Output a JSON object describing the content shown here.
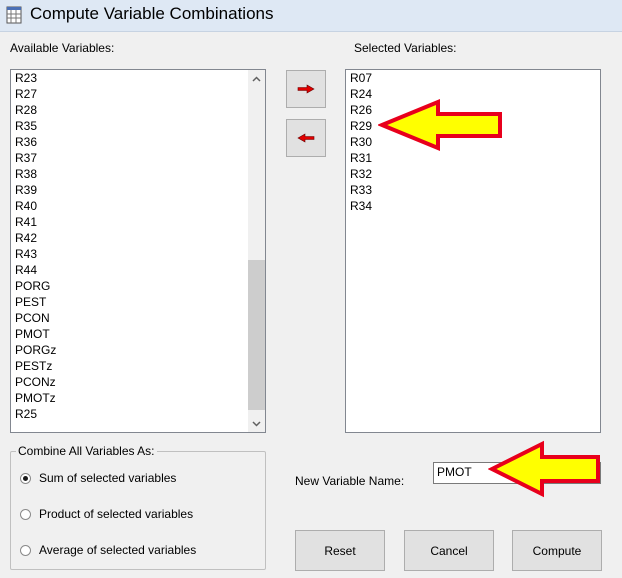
{
  "window": {
    "title": "Compute Variable Combinations",
    "icon": "app-table-icon"
  },
  "available": {
    "label": "Available Variables:",
    "items": [
      "R23",
      "R27",
      "R28",
      "R35",
      "R36",
      "R37",
      "R38",
      "R39",
      "R40",
      "R41",
      "R42",
      "R43",
      "R44",
      "PORG",
      "PEST",
      "PCON",
      "PMOT",
      "PORGz",
      "PESTz",
      "PCONz",
      "PMOTz",
      "R25"
    ],
    "scroll_up_icon": "chevron-up-icon",
    "scroll_down_icon": "chevron-down-icon"
  },
  "transfer": {
    "add_icon": "red-arrow-right-icon",
    "remove_icon": "red-arrow-left-icon"
  },
  "selected": {
    "label": "Selected Variables:",
    "items": [
      "R07",
      "R24",
      "R26",
      "R29",
      "R30",
      "R31",
      "R32",
      "R33",
      "R34"
    ]
  },
  "combine": {
    "legend": "Combine All Variables As:",
    "options": [
      "Sum of selected variables",
      "Product of selected variables",
      "Average of selected variables"
    ],
    "selected_option": "Sum of selected variables"
  },
  "new_variable": {
    "label": "New Variable Name:",
    "value": "PMOT"
  },
  "buttons": {
    "reset": "Reset",
    "cancel": "Cancel",
    "compute": "Compute"
  },
  "annotations": {
    "arrow_color": "#ffff00",
    "arrow_outline": "#e8001c"
  }
}
